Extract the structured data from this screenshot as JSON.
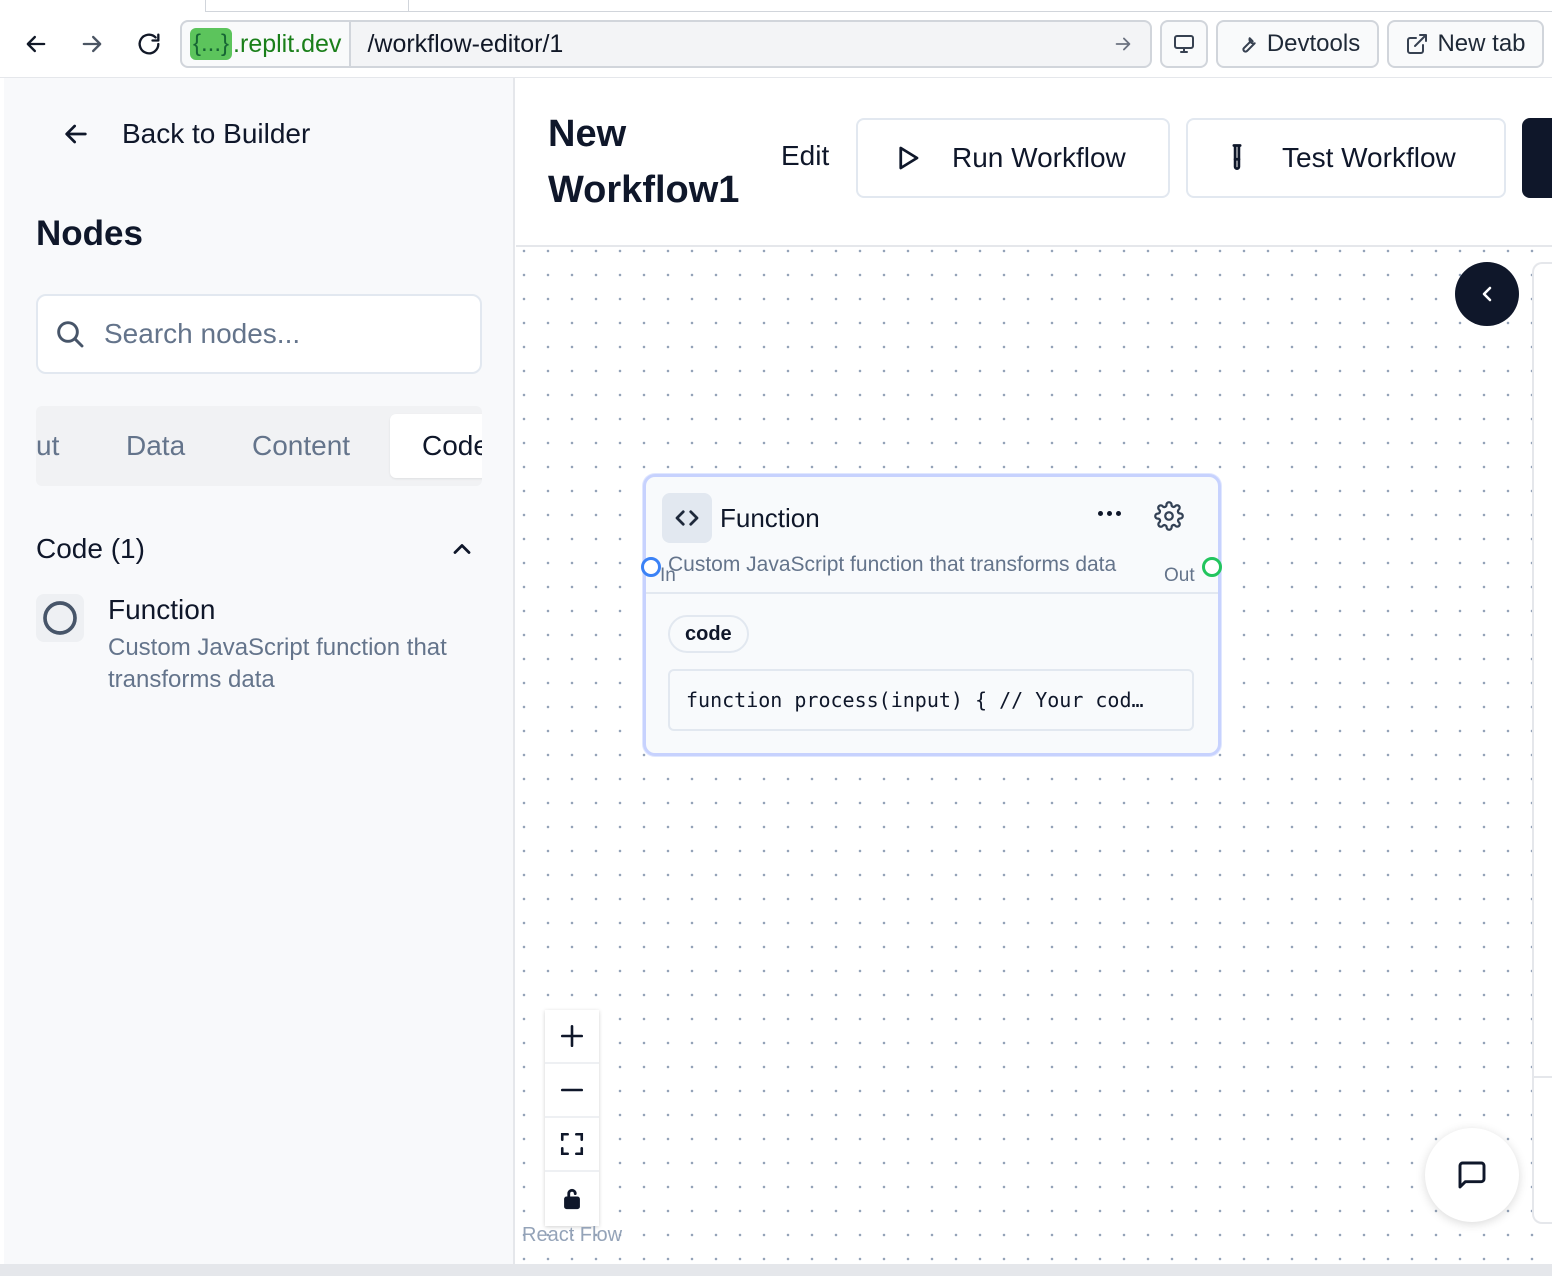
{
  "browser": {
    "host_badge": "{...}",
    "host_domain": ".replit.dev",
    "path": "/workflow-editor/1",
    "devtools_label": "Devtools",
    "new_tab_label": "New tab"
  },
  "sidebar": {
    "back_label": "Back to Builder",
    "title": "Nodes",
    "search_placeholder": "Search nodes...",
    "tabs": [
      {
        "label": "ut",
        "active": false
      },
      {
        "label": "Data",
        "active": false
      },
      {
        "label": "Content",
        "active": false
      },
      {
        "label": "Code",
        "active": true
      }
    ],
    "section_label": "Code (1)",
    "items": [
      {
        "name": "Function",
        "description": "Custom JavaScript function that transforms data"
      }
    ]
  },
  "header": {
    "workflow_title_line1": "New",
    "workflow_title_line2": "Workflow1",
    "edit_label": "Edit",
    "run_label": "Run Workflow",
    "test_label": "Test Workflow"
  },
  "canvas": {
    "node": {
      "title": "Function",
      "description": "Custom JavaScript function that transforms data",
      "in_label": "In",
      "out_label": "Out",
      "param_chip": "code",
      "code_preview": "function process(input) { // Your cod…"
    },
    "attribution": "React Flow"
  },
  "colors": {
    "primary_dark": "#0f172a",
    "input_handle": "#3b82f6",
    "output_handle": "#22c55e",
    "node_border": "#c7d2fe"
  }
}
